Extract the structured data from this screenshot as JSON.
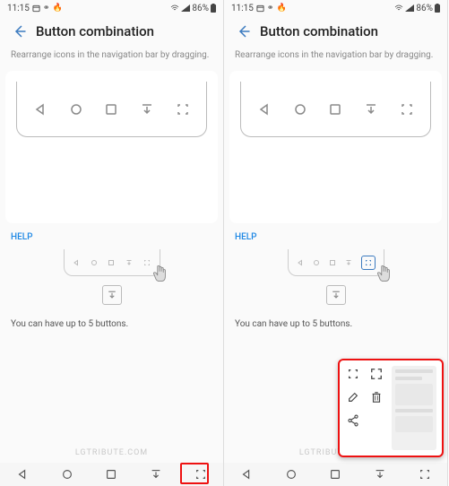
{
  "status": {
    "time": "11:15",
    "battery": "86%"
  },
  "header": {
    "title": "Button combination"
  },
  "subtitle": "Rearrange icons in the navigation bar by dragging.",
  "help": {
    "label": "HELP",
    "text": "You can have up to 5 buttons."
  },
  "watermark": "LGTRIBUTE.COM"
}
